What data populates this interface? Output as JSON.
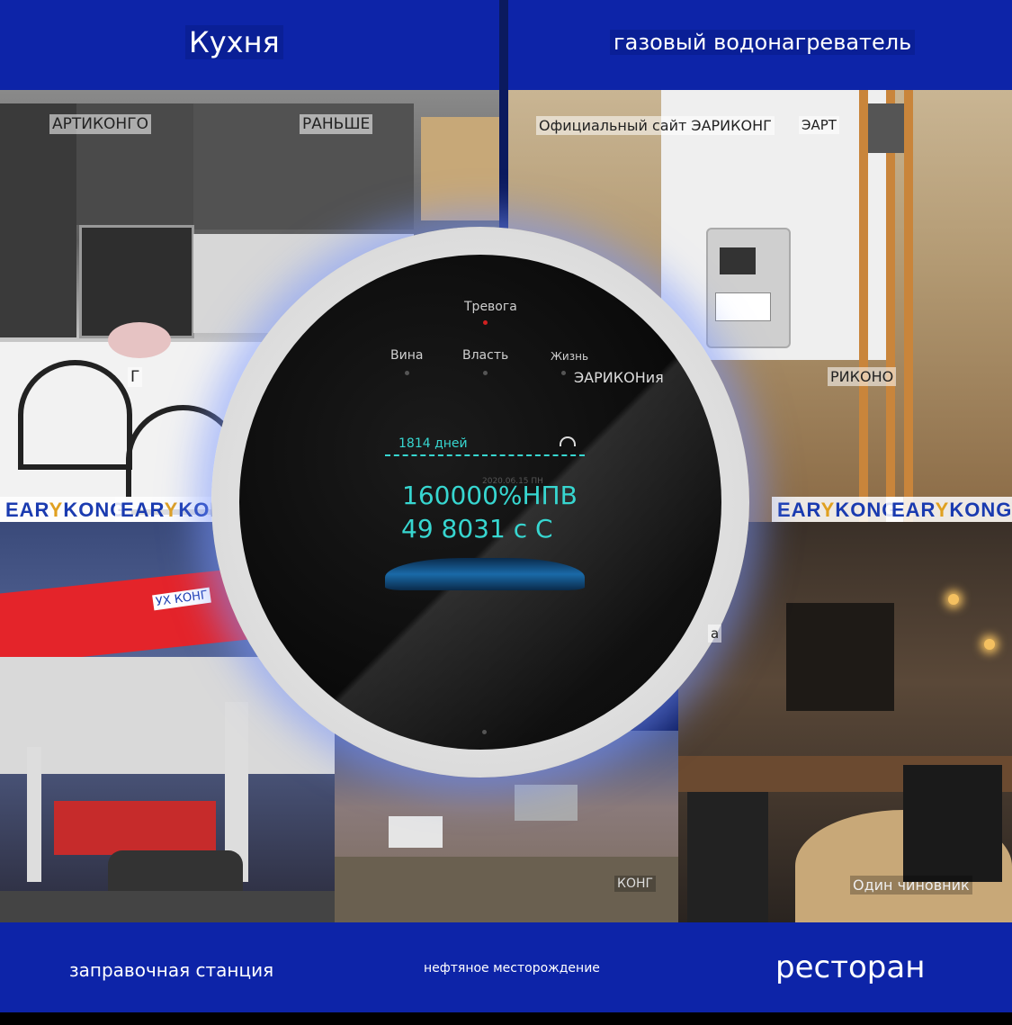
{
  "bands": {
    "kitchen": "Кухня",
    "water_heater": "газовый водонагреватель",
    "gas_station": "заправочная станция",
    "oil_field": "нефтяное месторождение",
    "restaurant": "ресторан"
  },
  "watermarks": {
    "artikongo": "АРТИКОНГО",
    "before": "РАНЬШЕ",
    "official_site": "Официальный сайт ЭАРИКОНГ",
    "eart": "ЭАРТ",
    "g": "Г",
    "rikono": "РИКОНО",
    "uh_kong": "УХ КОНГ",
    "a": "a",
    "kong": "КОНГ",
    "one_official": "Один чиновник",
    "earykonia": "ЭАРИКОНия"
  },
  "logos": [
    {
      "pre": "EAR",
      "mark": "Y",
      "post": "KONG"
    },
    {
      "pre": "EAR",
      "mark": "Y",
      "post": "KONG"
    },
    {
      "pre": "EAR",
      "mark": "Y",
      "post": "KONG"
    },
    {
      "pre": "EAR",
      "mark": "Y",
      "post": "KONG"
    }
  ],
  "device": {
    "alarm": "Тревога",
    "fault": "Вина",
    "power": "Власть",
    "life": "Жизнь",
    "days": "1814 дней",
    "date": "2020.06.15 ПН",
    "lel": "160000%НПВ",
    "temp": "49 8031 с С"
  },
  "colors": {
    "band": "#0d24a8",
    "screen_text": "#37d6d0",
    "alarm_led": "#d02020"
  }
}
